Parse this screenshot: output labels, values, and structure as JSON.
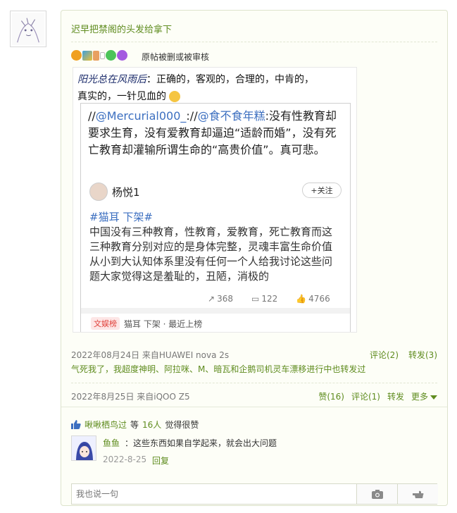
{
  "post": {
    "title": "迟早把禁阁的头发给拿下",
    "deleted_note": "原帖被删或被审核",
    "meta": "2022年08月24日   来自HUAWEI nova 2s",
    "comment_label": "评论(2)",
    "repost_label": "转发(3)",
    "repost_line": "气死我了，我超度神明、阿拉咪、M、暗瓦和企鹅司机灵车漂移进行中也转发过"
  },
  "screenshot": {
    "line1_hand": "阳光总在风雨后",
    "line1_text": "：正确的，客观的，合理的，中肯的，",
    "line2_text": "真实的，一针见血的",
    "repost_prefix": "//",
    "at1": "@Mercurial000_",
    "sep": "://",
    "at2": "@食不食年糕",
    "repost_body": ":没有性教育却要求生育，没有爱教育却逼迫“适龄而婚”，没有死亡教育却灌输所谓生命的“高贵价值”。真可悲。",
    "orig_name": "杨悦1",
    "follow": "+关注",
    "tags": "#猫耳 下架#",
    "orig_body": "中国没有三种教育，性教育，爱教育，死亡教育而这三种教育分别对应的是身体完整，灵魂丰富生命价值从小到大认知体系里没有任何一个人给我讨论这些问题大家觉得这是羞耻的，丑陋，消极的",
    "stat_repost": "368",
    "stat_comment": "122",
    "stat_like": "4766",
    "hot_tag": "文娱榜",
    "hot_text": "猫耳 下架 · 最近上榜"
  },
  "footer": {
    "meta": "2022年8月25日   来自iQOO Z5",
    "like": "赞(16)",
    "comment": "评论(1)",
    "repost": "转发",
    "more": "更多"
  },
  "comments": {
    "liker": "啾啾栖鸟过",
    "liker_suffix": "等",
    "like_count": "16人",
    "like_tail": "觉得很赞",
    "items": [
      {
        "user": "鱼鱼",
        "text": "：这些东西如果自学起来，就会出大问题",
        "time": "2022-8-25",
        "reply": "回复"
      }
    ],
    "input_placeholder": "我也说一句"
  },
  "colors": {
    "accent": "#5f8c1f",
    "link_blue": "#3c6fc0",
    "hot_red": "#e0403a"
  }
}
